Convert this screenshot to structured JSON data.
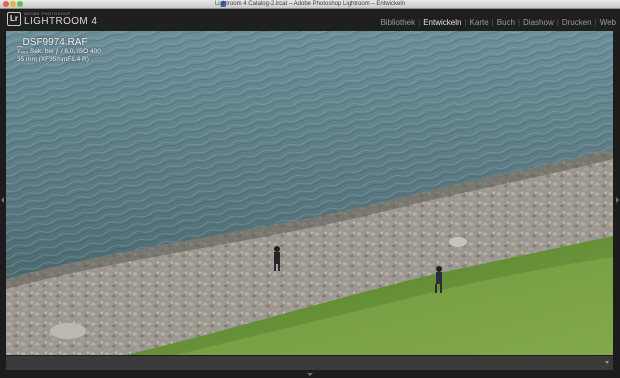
{
  "window": {
    "title": "Lightroom 4 Catalog-2.lrcat – Adobe Photoshop Lightroom – Entwickeln"
  },
  "identity_plate": {
    "badge": "Lr",
    "small_text": "ADOBE PHOTOSHOP",
    "title": "LIGHTROOM 4"
  },
  "modules": [
    {
      "label": "Bibliothek",
      "active": false
    },
    {
      "label": "Entwickeln",
      "active": true
    },
    {
      "label": "Karte",
      "active": false
    },
    {
      "label": "Buch",
      "active": false
    },
    {
      "label": "Diashow",
      "active": false
    },
    {
      "label": "Drucken",
      "active": false
    },
    {
      "label": "Web",
      "active": false
    }
  ],
  "photo_info": {
    "filename": "_DSF9974.RAF",
    "exposure": "¹⁄₄₅₀ Sek. bei ƒ / 8,0, ISO 400",
    "lens": "35 mm (XF35mmF1.4 R)"
  },
  "colors": {
    "water": "#5d7f89",
    "grass": "#5f8a33",
    "stones": "#9c988f"
  }
}
